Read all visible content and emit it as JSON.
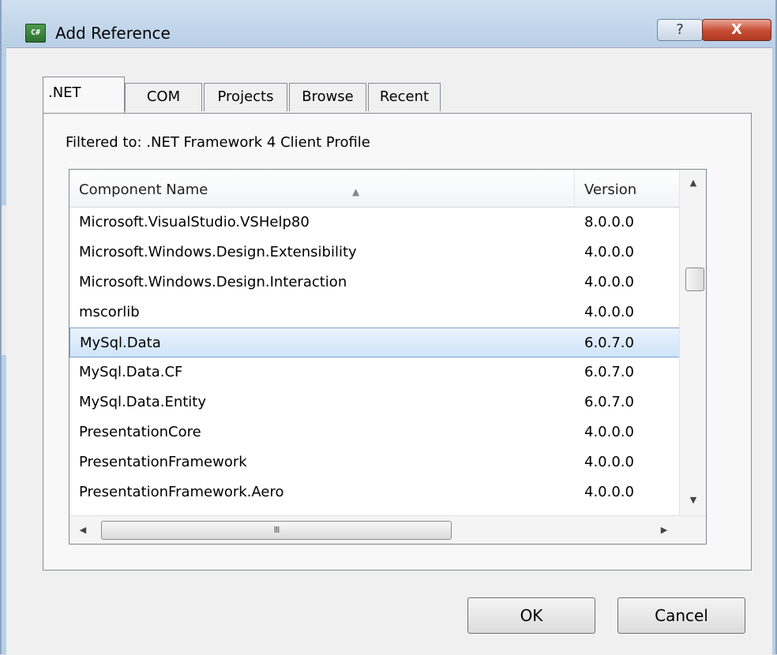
{
  "window": {
    "title": "Add Reference",
    "app_icon": "C#",
    "help_symbol": "?",
    "close_symbol": "X"
  },
  "tabs": [
    ".NET",
    "COM",
    "Projects",
    "Browse",
    "Recent"
  ],
  "filter_text": "Filtered to: .NET Framework 4 Client Profile",
  "list": {
    "columns": [
      "Component Name",
      "Version"
    ],
    "sort_indicator": "▲",
    "rows": [
      {
        "name": "Microsoft.VisualStudio.VSHelp80",
        "version": "8.0.0.0"
      },
      {
        "name": "Microsoft.Windows.Design.Extensibility",
        "version": "4.0.0.0"
      },
      {
        "name": "Microsoft.Windows.Design.Interaction",
        "version": "4.0.0.0"
      },
      {
        "name": "mscorlib",
        "version": "4.0.0.0"
      },
      {
        "name": "MySql.Data",
        "version": "6.0.7.0"
      },
      {
        "name": "MySql.Data.CF",
        "version": "6.0.7.0"
      },
      {
        "name": "MySql.Data.Entity",
        "version": "6.0.7.0"
      },
      {
        "name": "PresentationCore",
        "version": "4.0.0.0"
      },
      {
        "name": "PresentationFramework",
        "version": "4.0.0.0"
      },
      {
        "name": "PresentationFramework.Aero",
        "version": "4.0.0.0"
      }
    ],
    "selected_row": "MySql.Data",
    "hscroll_grip": "III"
  },
  "buttons": {
    "ok": "OK",
    "cancel": "Cancel"
  }
}
